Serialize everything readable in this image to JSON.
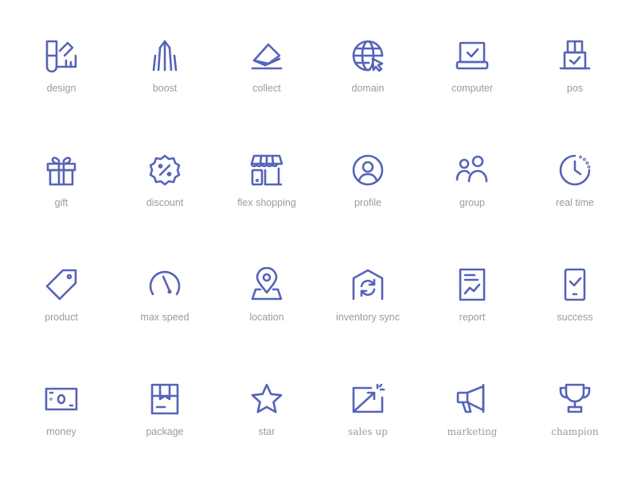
{
  "icon_color": "#5563b8",
  "label_color": "#9a9aa2",
  "icons": [
    {
      "name": "design-icon",
      "label": "design"
    },
    {
      "name": "boost-icon",
      "label": "boost"
    },
    {
      "name": "collect-icon",
      "label": "collect"
    },
    {
      "name": "domain-icon",
      "label": "domain"
    },
    {
      "name": "computer-icon",
      "label": "computer"
    },
    {
      "name": "pos-icon",
      "label": "pos"
    },
    {
      "name": "gift-icon",
      "label": "gift"
    },
    {
      "name": "discount-icon",
      "label": "discount"
    },
    {
      "name": "flex-shopping-icon",
      "label": "flex shopping"
    },
    {
      "name": "profile-icon",
      "label": "profile"
    },
    {
      "name": "group-icon",
      "label": "group"
    },
    {
      "name": "real-time-icon",
      "label": "real time"
    },
    {
      "name": "product-icon",
      "label": "product"
    },
    {
      "name": "max-speed-icon",
      "label": "max speed"
    },
    {
      "name": "location-icon",
      "label": "location"
    },
    {
      "name": "inventory-sync-icon",
      "label": "inventory sync"
    },
    {
      "name": "report-icon",
      "label": "report"
    },
    {
      "name": "success-icon",
      "label": "success"
    },
    {
      "name": "money-icon",
      "label": "money"
    },
    {
      "name": "package-icon",
      "label": "package"
    },
    {
      "name": "star-icon",
      "label": "star"
    },
    {
      "name": "sales-up-icon",
      "label": "sales up"
    },
    {
      "name": "marketing-icon",
      "label": "marketing"
    },
    {
      "name": "champion-icon",
      "label": "champion"
    }
  ]
}
